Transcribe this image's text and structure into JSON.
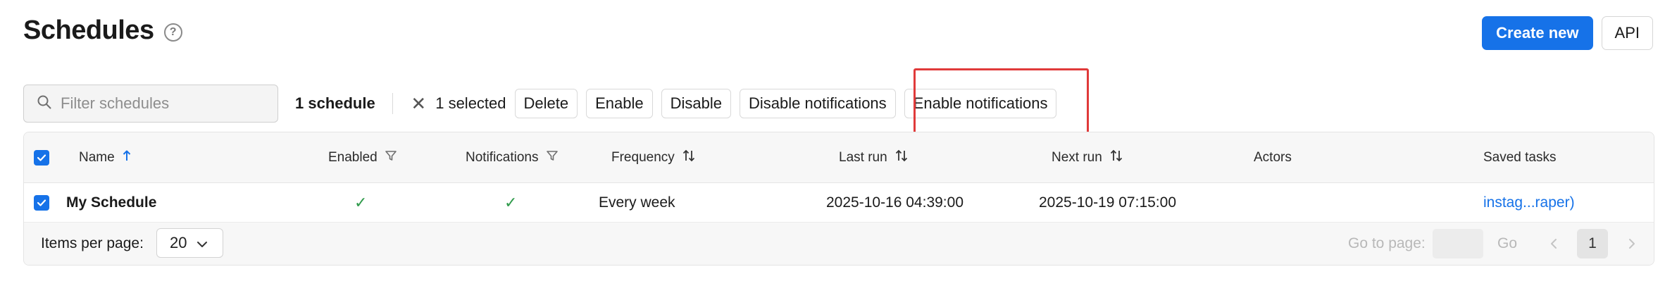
{
  "page": {
    "title": "Schedules",
    "help_glyph": "?"
  },
  "header": {
    "create_label": "Create new",
    "api_label": "API"
  },
  "toolbar": {
    "search_placeholder": "Filter schedules",
    "count": "1 schedule",
    "clear_glyph": "✕",
    "selected": "1 selected",
    "delete_label": "Delete",
    "enable_label": "Enable",
    "disable_label": "Disable",
    "disable_notifications_label": "Disable notifications",
    "enable_notifications_label": "Enable notifications"
  },
  "table": {
    "columns": {
      "name": "Name",
      "enabled": "Enabled",
      "notifications": "Notifications",
      "frequency": "Frequency",
      "last_run": "Last run",
      "next_run": "Next run",
      "actors": "Actors",
      "saved_tasks": "Saved tasks"
    },
    "rows": [
      {
        "name": "My Schedule",
        "enabled": "✓",
        "notifications": "✓",
        "frequency": "Every week",
        "last_run": "2025-10-16 04:39:00",
        "next_run": "2025-10-19 07:15:00",
        "actors": "",
        "saved_tasks": "instag...raper)"
      }
    ]
  },
  "footer": {
    "items_per_page_label": "Items per page:",
    "items_per_page_value": "20",
    "goto_label": "Go to page:",
    "go_label": "Go",
    "current_page": "1"
  },
  "colors": {
    "accent": "#1672e8",
    "check": "#2e9a4a",
    "highlight": "#e03a3a"
  }
}
